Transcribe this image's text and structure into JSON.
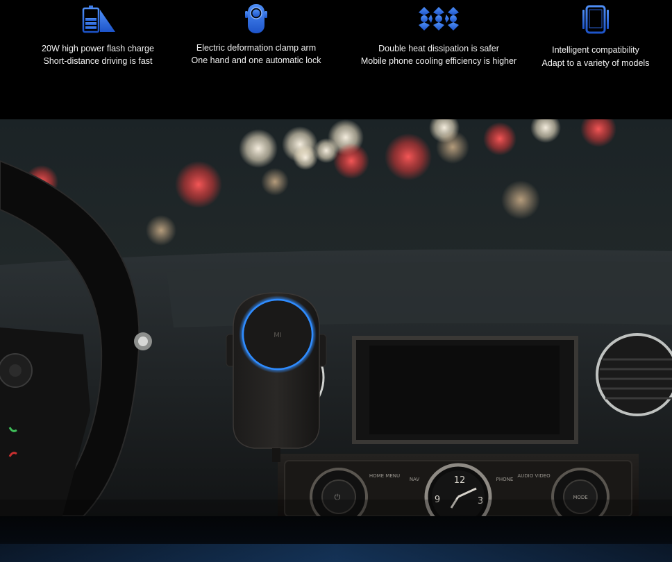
{
  "features": [
    {
      "icon": "battery-flash-icon",
      "line1": "20W high power flash charge",
      "line2": "Short-distance driving is fast"
    },
    {
      "icon": "clamp-arm-icon",
      "line1": "Electric deformation clamp arm",
      "line2": "One hand and one automatic lock"
    },
    {
      "icon": "fan-cooling-icon",
      "line1": "Double heat dissipation is safer",
      "line2": "Mobile phone cooling efficiency is higher"
    },
    {
      "icon": "phone-icon",
      "line1": "Intelligent compatibility",
      "line2": "Adapt to a variety of models"
    }
  ],
  "colors": {
    "icon_blue": "#1f6fe8",
    "ring_blue": "#2f8cff",
    "background": "#000000"
  },
  "photo": {
    "charger_logo": "MI",
    "console_buttons": {
      "home_menu": "HOME MENU",
      "nav": "NAV",
      "phone": "PHONE",
      "audio_video": "AUDIO VIDEO",
      "mode": "MODE"
    },
    "clock_numbers": {
      "twelve": "12",
      "three": "3",
      "nine": "9"
    }
  }
}
